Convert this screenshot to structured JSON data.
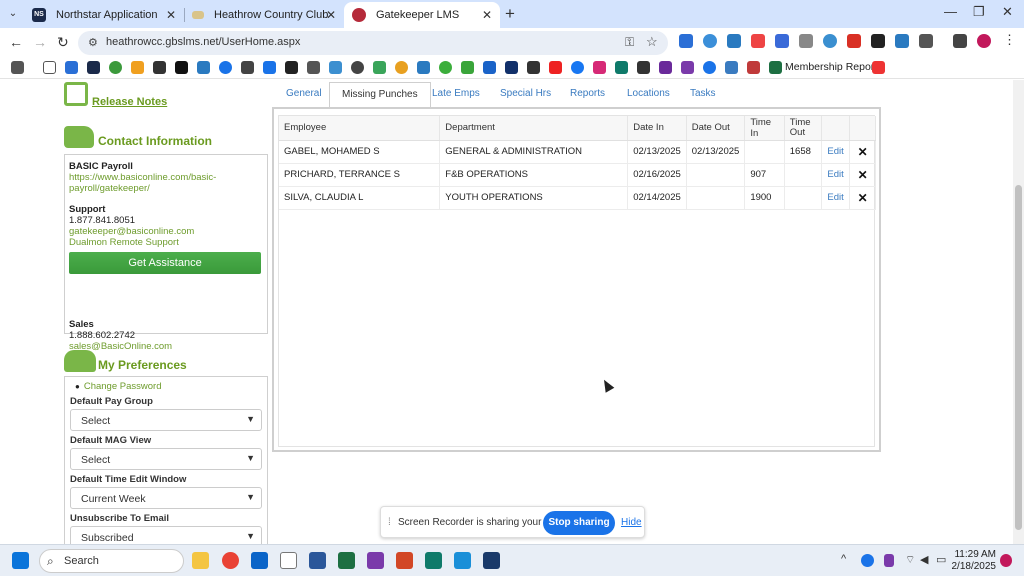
{
  "browser": {
    "tabs": [
      {
        "label": "Northstar Application",
        "favicon": "NS"
      },
      {
        "label": "Heathrow Country Club",
        "favicon": "heathrow-icon"
      },
      {
        "label": "Gatekeeper LMS",
        "favicon": "gatekeeper-icon"
      }
    ],
    "url": "heathrowcc.gbslms.net/UserHome.aspx",
    "bookmark_label": "Membership Report..."
  },
  "left": {
    "release_notes": "Release Notes",
    "contact_title": "Contact Information",
    "basic_payroll": "BASIC Payroll",
    "basic_payroll_url": "https://www.basiconline.com/basic-payroll/gatekeeper/",
    "support_label": "Support",
    "support_phone": "1.877.841.8051",
    "support_email": "gatekeeper@basiconline.com",
    "remote_support": "Dualmon Remote Support",
    "assist_button": "Get Assistance",
    "sales_label": "Sales",
    "sales_phone": "1.888.602.2742",
    "sales_email": "sales@BasicOnline.com",
    "prefs_title": "My Preferences",
    "change_password": "Change Password",
    "prefs": [
      {
        "label": "Default Pay Group",
        "value": "Select"
      },
      {
        "label": "Default MAG View",
        "value": "Select"
      },
      {
        "label": "Default Time Edit Window",
        "value": "Current Week"
      },
      {
        "label": "Unsubscribe To Email",
        "value": "Subscribed"
      }
    ]
  },
  "tabs": [
    "General",
    "Missing Punches",
    "Late Emps",
    "Special Hrs",
    "Reports",
    "Locations",
    "Tasks"
  ],
  "active_tab": "Missing Punches",
  "table": {
    "headers": [
      "Employee",
      "Department",
      "Date In",
      "Date Out",
      "Time In",
      "Time Out"
    ],
    "rows": [
      {
        "employee": "GABEL, MOHAMED S",
        "department": "GENERAL & ADMINISTRATION",
        "date_in": "02/13/2025",
        "date_out": "02/13/2025",
        "time_in": "",
        "time_out": "1658",
        "edit": "Edit"
      },
      {
        "employee": "PRICHARD, TERRANCE S",
        "department": "F&B OPERATIONS",
        "date_in": "02/16/2025",
        "date_out": "",
        "time_in": "907",
        "time_out": "",
        "edit": "Edit"
      },
      {
        "employee": "SILVA, CLAUDIA L",
        "department": "YOUTH OPERATIONS",
        "date_in": "02/14/2025",
        "date_out": "",
        "time_in": "1900",
        "time_out": "",
        "edit": "Edit"
      }
    ]
  },
  "share_bar": {
    "message": "Screen Recorder is sharing your screen.",
    "stop": "Stop sharing",
    "hide": "Hide"
  },
  "taskbar": {
    "search": "Search",
    "time": "11:29 AM",
    "date": "2/18/2025"
  },
  "colors": {
    "accent_green": "#6a9a1f",
    "link_blue": "#3a7bc0",
    "button_blue": "#1a73e8"
  }
}
